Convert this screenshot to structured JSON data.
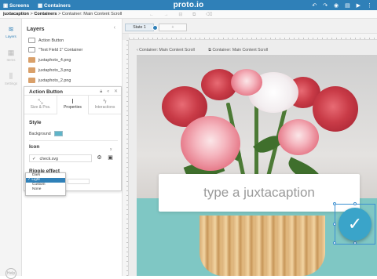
{
  "topbar": {
    "screens_label": "Screens",
    "containers_label": "Containers",
    "brand": "proto.io",
    "icons": [
      "undo-icon",
      "redo-icon",
      "eye-icon",
      "grid-icon",
      "play-icon",
      "more-icon"
    ],
    "bg_color": "#2f80b8"
  },
  "breadcrumb": {
    "project": "juxtacaption",
    "sep1": " > ",
    "containers": "Containers",
    "sep2": " > ",
    "current": "Container: Main Content Scroll"
  },
  "iconbar": {
    "items": [
      {
        "label": "Layers",
        "icon": "layers-icon",
        "active": true
      },
      {
        "label": "Items",
        "icon": "items-icon",
        "active": false
      },
      {
        "label": "Settings",
        "icon": "settings-icon",
        "active": false
      }
    ],
    "help": "Help"
  },
  "layers": {
    "title": "Layers",
    "items": [
      {
        "label": "Action Button",
        "thumb": "button"
      },
      {
        "label": "\"Text Field 1\" Container",
        "thumb": "text"
      },
      {
        "label": "juxtaphoto_4.png",
        "thumb": "image"
      },
      {
        "label": "juxtaphoto_3.png",
        "thumb": "image"
      },
      {
        "label": "juxtaphoto_2.png",
        "thumb": "image"
      }
    ]
  },
  "props": {
    "title": "Action Button",
    "tabs": [
      {
        "label": "Size & Pos.",
        "icon": "resize-icon",
        "active": false
      },
      {
        "label": "Properties",
        "icon": "text-cursor-icon",
        "active": true
      },
      {
        "label": "Interactions",
        "icon": "lightning-icon",
        "active": false
      }
    ],
    "style_title": "Style",
    "background_label": "Background",
    "background_color": "#5fb4c8",
    "icon_title": "Icon",
    "icon_value": "check.svg",
    "ripple_title": "Ripple effect",
    "ripple_options": [
      "Dark",
      "Light",
      "Custom",
      "None"
    ],
    "ripple_selected": "Light"
  },
  "canvas": {
    "state_label": "State 1",
    "breadcrumb_a": "Container: Main Content Scroll",
    "breadcrumb_b": "Container: Main Content Scroll",
    "caption_text": "type a juxtacaption",
    "fab_icon": "check-icon",
    "teal_color": "#7fc7c4",
    "fab_color": "#3aa4c9"
  }
}
